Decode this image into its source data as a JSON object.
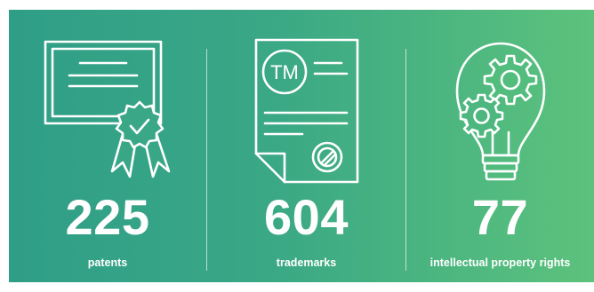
{
  "stats": [
    {
      "value": "225",
      "label": "patents",
      "icon": "certificate-ribbon-icon"
    },
    {
      "value": "604",
      "label": "trademarks",
      "icon": "trademark-document-icon"
    },
    {
      "value": "77",
      "label": "intellectual property rights",
      "icon": "lightbulb-gears-icon"
    }
  ],
  "icon_trademark_text": "TM",
  "colors": {
    "gradient_start": "#2f9e87",
    "gradient_end": "#5cc27c",
    "foreground": "#ffffff"
  }
}
